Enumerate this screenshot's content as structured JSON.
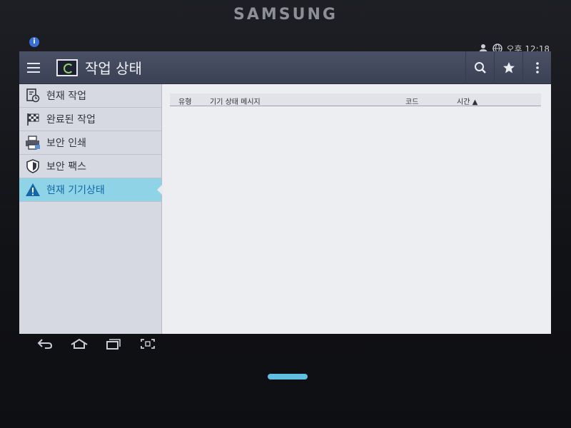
{
  "device": {
    "brand": "SAMSUNG"
  },
  "statusbar": {
    "time": "오후 12:18",
    "icons": [
      "person-icon",
      "globe-icon"
    ]
  },
  "appbar": {
    "title": "작업 상태",
    "actions": [
      "search-icon",
      "star-icon",
      "overflow-menu-icon"
    ]
  },
  "sidebar": {
    "items": [
      {
        "label": "현재 작업",
        "icon": "document-clock-icon",
        "active": false
      },
      {
        "label": "완료된 작업",
        "icon": "checkered-flag-icon",
        "active": false
      },
      {
        "label": "보안 인쇄",
        "icon": "printer-icon",
        "active": false
      },
      {
        "label": "보안 팩스",
        "icon": "shield-icon",
        "active": false
      },
      {
        "label": "현재 기기상태",
        "icon": "warning-icon",
        "active": true
      }
    ]
  },
  "table": {
    "columns": {
      "type": "유형",
      "message": "기기 상태 메시지",
      "code": "코드",
      "time": "시간 ▲"
    },
    "rows": []
  },
  "navbar": {
    "buttons": [
      "back-icon",
      "home-icon",
      "recent-apps-icon",
      "screenshot-icon"
    ]
  },
  "colors": {
    "appbar": "#434a5e",
    "active_item": "#8fd3e6",
    "active_text": "#1466a8",
    "home_key": "#5fc0e2"
  }
}
